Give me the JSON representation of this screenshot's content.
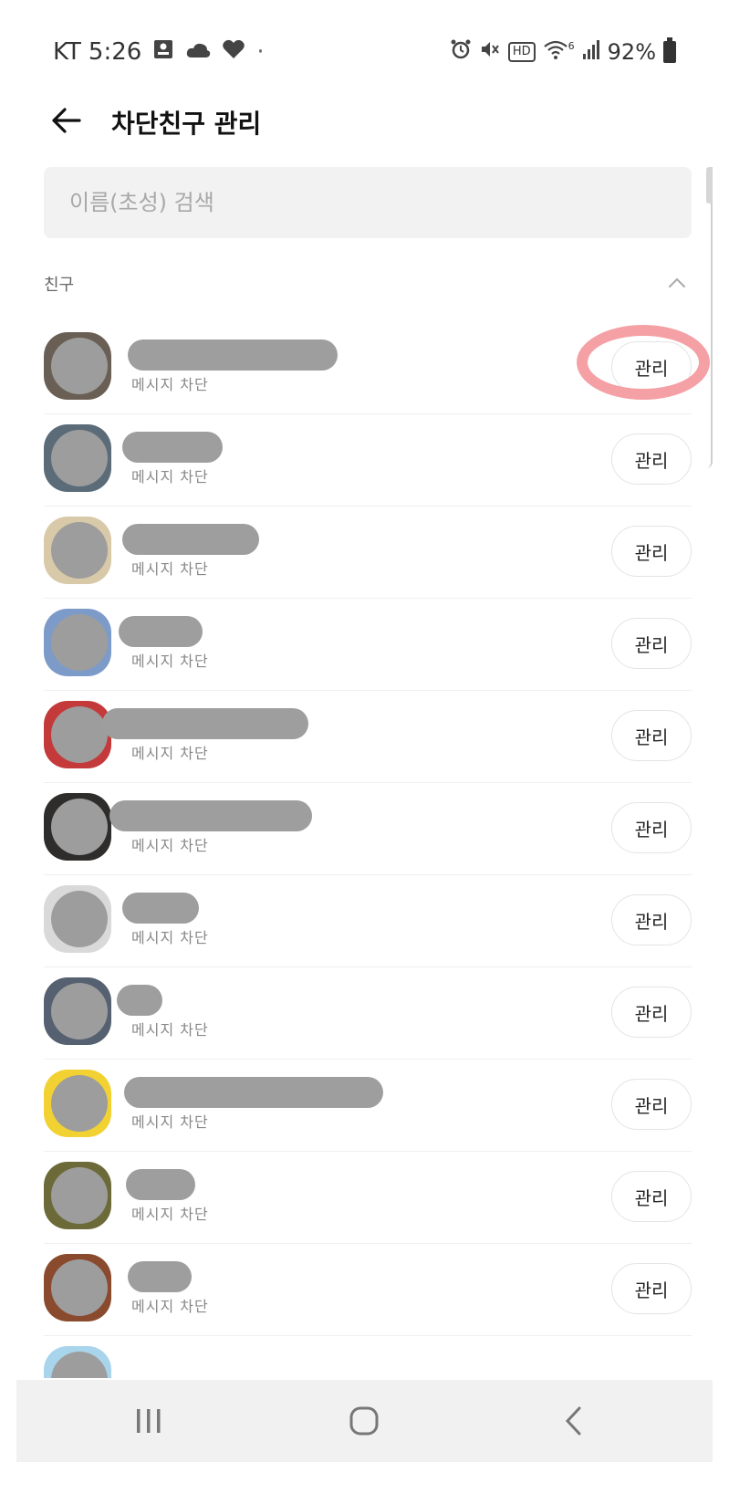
{
  "status_bar": {
    "carrier": "KT",
    "time": "5:26",
    "dot": "·",
    "battery_percent": "92%",
    "network_type_superscript": "6",
    "icons_left": [
      "message-icon",
      "cloud-icon",
      "heart-icon"
    ],
    "icons_right": [
      "alarm-icon",
      "mute-icon",
      "hd-voice-icon",
      "wifi-icon",
      "signal-icon",
      "battery-icon"
    ],
    "hd_label": "HD"
  },
  "app_bar": {
    "title": "차단친구 관리"
  },
  "search": {
    "placeholder": "이름(초성) 검색",
    "value": ""
  },
  "section": {
    "title": "친구",
    "expanded": true
  },
  "friends": [
    {
      "status": "메시지 차단",
      "button": "관리",
      "avatar_color": "#6a5f55"
    },
    {
      "status": "메시지 차단",
      "button": "관리",
      "avatar_color": "#5b6b78"
    },
    {
      "status": "메시지 차단",
      "button": "관리",
      "avatar_color": "#d8c9a8"
    },
    {
      "status": "메시지 차단",
      "button": "관리",
      "avatar_color": "#7d9bc9"
    },
    {
      "status": "메시지 차단",
      "button": "관리",
      "avatar_color": "#c43a3a"
    },
    {
      "status": "메시지 차단",
      "button": "관리",
      "avatar_color": "#2f2d2b"
    },
    {
      "status": "메시지 차단",
      "button": "관리",
      "avatar_color": "#d9d9d9"
    },
    {
      "status": "메시지 차단",
      "button": "관리",
      "avatar_color": "#556070"
    },
    {
      "status": "메시지 차단",
      "button": "관리",
      "avatar_color": "#f2d232"
    },
    {
      "status": "메시지 차단",
      "button": "관리",
      "avatar_color": "#6d6a3a"
    },
    {
      "status": "메시지 차단",
      "button": "관리",
      "avatar_color": "#8a4a2e"
    },
    {
      "status": "",
      "button": "",
      "avatar_color": "#a8d4ec"
    }
  ],
  "annotation": {
    "color": "#f4a0a4"
  },
  "nav_bar": {
    "buttons": [
      "recents-icon",
      "home-icon",
      "back-icon"
    ]
  },
  "colors": {
    "search_bg": "#f2f2f2",
    "status_text": "#888888",
    "redaction": "#9e9e9e",
    "nav_bg": "#f1f1f1"
  }
}
